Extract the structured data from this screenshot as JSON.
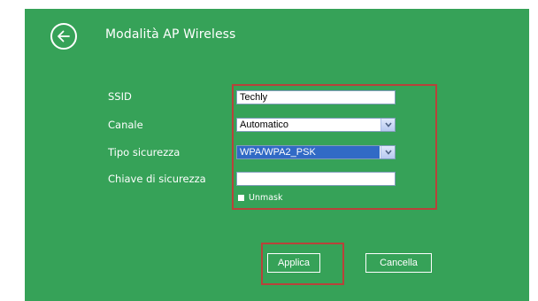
{
  "header": {
    "title": "Modalità AP Wireless",
    "back_icon": "arrow-left-circle-icon"
  },
  "form": {
    "ssid": {
      "label": "SSID",
      "value": "Techly"
    },
    "channel": {
      "label": "Canale",
      "value": "Automatico"
    },
    "security_type": {
      "label": "Tipo sicurezza",
      "value": "WPA/WPA2_PSK"
    },
    "security_key": {
      "label": "Chiave di sicurezza",
      "value": ""
    },
    "unmask": {
      "label": "Unmask",
      "checked": false
    }
  },
  "actions": {
    "apply_label": "Applica",
    "cancel_label": "Cancella"
  },
  "colors": {
    "panel_bg": "#36a258",
    "highlight": "#b8423a",
    "selection": "#316ac5"
  }
}
